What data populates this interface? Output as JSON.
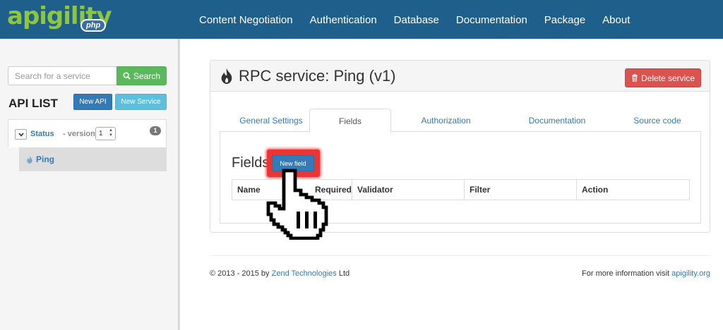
{
  "header": {
    "logo_text": "apigility",
    "logo_badge": "php",
    "nav": [
      "Content Negotiation",
      "Authentication",
      "Database",
      "Documentation",
      "Package",
      "About"
    ]
  },
  "sidebar": {
    "search_placeholder": "Search for a service",
    "search_button": "Search",
    "api_list_title": "API LIST",
    "new_api_button": "New API",
    "new_service_button": "New Service",
    "api": {
      "name": "Status",
      "version_label": "- version",
      "version_value": "1",
      "badge_count": "1"
    },
    "service_label": "Ping"
  },
  "main": {
    "title": "RPC service: Ping (v1)",
    "delete_button": "Delete service",
    "tabs": [
      "General Settings",
      "Fields",
      "Authorization",
      "Documentation",
      "Source code"
    ],
    "active_tab": "Fields",
    "fields_heading": "Fields",
    "new_field_button": "New field",
    "table_headers": [
      "Name",
      "Required",
      "Validator",
      "Filter",
      "Action"
    ]
  },
  "footer": {
    "copyright_prefix": "© 2013 - 2015 by ",
    "company_link": "Zend Technologies",
    "copyright_suffix": " Ltd",
    "info_prefix": "For more information visit ",
    "info_link": "apigility.org"
  },
  "colors": {
    "navbar": "#1f5f8b",
    "logo_green": "#8dc63f",
    "primary": "#337ab7",
    "success": "#5cb85c",
    "info": "#5bc0de",
    "danger": "#d9534f"
  }
}
